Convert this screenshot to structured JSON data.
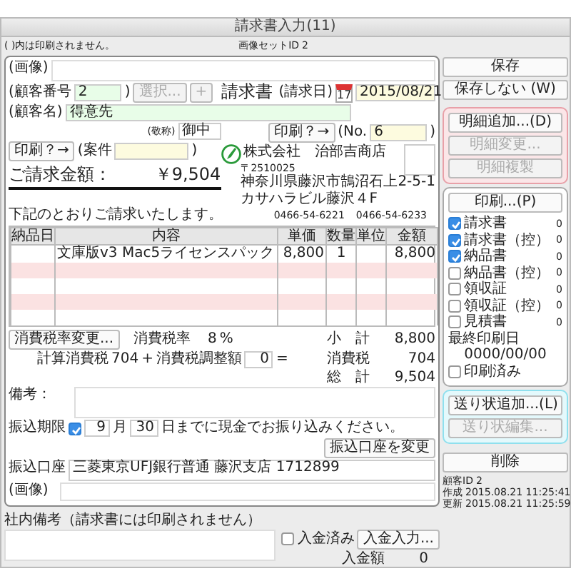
{
  "window": {
    "title": "請求書入力(11)"
  },
  "note": "( )内は印刷されません。",
  "image_set": {
    "label": "画像セットID",
    "value": "2"
  },
  "image_top": {
    "label": "(画像)"
  },
  "customer_number": {
    "label": "(顧客番号",
    "value": "2",
    "close": ")",
    "select_button": {
      "label": "選択...",
      "disabled": true
    },
    "add_button": {
      "label": "+",
      "disabled": true
    }
  },
  "doc_title": "請求書",
  "invoice_date": {
    "label": "(請求日)",
    "calendar_day": "17",
    "value": "2015/08/21"
  },
  "customer_name": {
    "label": "(顧客名)",
    "value": "得意先"
  },
  "honorific": {
    "label": "(敬称)",
    "value": "御中"
  },
  "print_toggle_left": "印刷？→",
  "case": {
    "label": "(案件",
    "close": ")"
  },
  "print_toggle_right": "印刷？→",
  "number": {
    "label": "(No.",
    "value": "6",
    "close": ")"
  },
  "company": {
    "name": "株式会社　治部吉商店",
    "postal": "〒2510025",
    "address": "神奈川県藤沢市鵠沼石上2-5-1",
    "building": "カサハラビル藤沢４F",
    "phones": [
      "0466-54-6221",
      "0466-54-6233"
    ]
  },
  "total": {
    "label": "ご請求金額：",
    "value": "￥9,504"
  },
  "intro": "下記のとおりご請求いたします。",
  "table": {
    "columns": [
      "納品日",
      "内容",
      "単価",
      "数量",
      "単位",
      "金額"
    ],
    "rows": [
      {
        "highlighted": false,
        "content": "文庫版v3 Mac5ライセンスパック",
        "unit_price": "8,800",
        "quantity": "1",
        "amount": "8,800"
      },
      {
        "highlighted": true
      },
      {
        "highlighted": false
      },
      {
        "highlighted": true
      },
      {
        "highlighted": false
      }
    ]
  },
  "tax": {
    "button": "消費税率変更...",
    "rate_label": "消費税率",
    "rate": "8",
    "percent": "%",
    "calc_label": "計算消費税",
    "calc": "704",
    "plus": "+",
    "adjust_label": "消費税調整額",
    "adjust": "0",
    "equals": "=",
    "totals": [
      {
        "label": "小　計",
        "value": "8,800"
      },
      {
        "label": "消費税",
        "value": "704"
      },
      {
        "label": "総　計",
        "value": "9,504"
      }
    ]
  },
  "remarks": {
    "label": "備考："
  },
  "deadline": {
    "label": "振込期限",
    "checked": true,
    "month": "9",
    "month_unit": "月",
    "day": "30",
    "text": "日までに現金でお振り込みください。"
  },
  "change_account_button": "振込口座を変更",
  "account": {
    "label": "振込口座",
    "value": "三菱東京UFJ銀行普通 藤沢支店 1712899"
  },
  "image_bottom": {
    "label": "(画像)"
  },
  "internal_note": {
    "label": "社内備考（請求書には印刷されません）"
  },
  "payment": {
    "received_label": "入金済み",
    "received": false,
    "button": "入金入力...",
    "amount_label": "入金額",
    "amount": "0"
  },
  "save_button": "保存",
  "discard_button": "保存しない (W)",
  "detail_buttons": [
    {
      "label": "明細追加...(D)",
      "disabled": false
    },
    {
      "label": "明細変更...",
      "disabled": true
    },
    {
      "label": "明細複製",
      "disabled": true
    }
  ],
  "print_button": "印刷...(P)",
  "print_docs": [
    {
      "label": "請求書",
      "checked": true,
      "count": "0"
    },
    {
      "label": "請求書（控）",
      "checked": true,
      "count": "0"
    },
    {
      "label": "納品書",
      "checked": true,
      "count": "0"
    },
    {
      "label": "納品書（控）",
      "checked": false,
      "count": "0"
    },
    {
      "label": "領収証",
      "checked": false,
      "count": "0"
    },
    {
      "label": "領収証（控）",
      "checked": false,
      "count": "0"
    },
    {
      "label": "見積書",
      "checked": false,
      "count": "0"
    }
  ],
  "last_print": {
    "label": "最終印刷日",
    "value": "0000/00/00"
  },
  "printed": {
    "label": "印刷済み",
    "checked": false
  },
  "shipping_buttons": [
    {
      "label": "送り状追加...(L)",
      "disabled": false
    },
    {
      "label": "送り状編集...",
      "disabled": true
    }
  ],
  "delete_button": "削除",
  "info": [
    {
      "label": "顧客ID",
      "value": "2"
    },
    {
      "label": "作成",
      "value": "2015.08.21 11:25:41"
    },
    {
      "label": "更新",
      "value": "2015.08.21 11:25:59"
    }
  ]
}
